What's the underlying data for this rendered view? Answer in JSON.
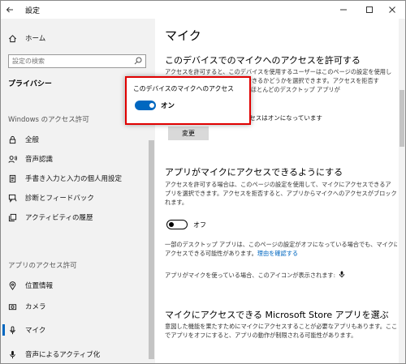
{
  "window": {
    "title": "設定"
  },
  "sidebar": {
    "home": "ホーム",
    "search_placeholder": "設定の検索",
    "section_title": "プライバシー",
    "group_windows": "Windows のアクセス許可",
    "windows_items": [
      {
        "label": "全般",
        "icon": "lock-icon"
      },
      {
        "label": "音声認識",
        "icon": "speech-icon"
      },
      {
        "label": "手書き入力と入力の個人用設定",
        "icon": "document-icon"
      },
      {
        "label": "診断とフィードバック",
        "icon": "feedback-icon"
      },
      {
        "label": "アクティビティの履歴",
        "icon": "history-icon"
      }
    ],
    "group_apps": "アプリのアクセス許可",
    "app_items": [
      {
        "label": "位置情報",
        "icon": "location-icon"
      },
      {
        "label": "カメラ",
        "icon": "camera-icon"
      },
      {
        "label": "マイク",
        "icon": "microphone-icon",
        "selected": true
      },
      {
        "label": "音声によるアクティブ化",
        "icon": "voice-activation-icon"
      }
    ]
  },
  "main": {
    "title": "マイク",
    "s1": {
      "heading": "このデバイスでのマイクへのアクセスを許可する",
      "p1": "アクセスを許可すると、このデバイスを使用するユーザーはこのページの設定を使用し",
      "p2": "て、アプリがマイクにアクセスできるかどうかを選択できます。アクセスを拒否す",
      "p3": "ると、Microsoft Store アプリ、ほとんどのデスクトップ アプリが",
      "status": "このデバイスのマイクへのアクセスはオンになっています",
      "change_button": "変更"
    },
    "s2": {
      "heading": "アプリがマイクにアクセスできるようにする",
      "p1": "アクセスを許可する場合は、このページの設定を使用して、マイクにアクセスできるア",
      "p2": "プリを選択できます。アクセスを拒否すると、アプリからマイクへのアクセスがブロックさ",
      "p3": "れます。",
      "toggle_label": "オフ",
      "toggle_state": "off",
      "note1": "一部のデスクトップ アプリは、このページの設定がオフになっている場合でも、マイクに",
      "note2_prefix": "アクセスできる可能性があります。",
      "note2_link": "理由を確認する",
      "icon_note": "アプリがマイクを使っている場合、このアイコンが表示されます:"
    },
    "s3": {
      "heading": "マイクにアクセスできる Microsoft Store アプリを選ぶ",
      "p1": "意図した機能を果たすためにマイクにアクセスすることが必要なアプリもあります。ここ",
      "p2": "でアプリをオフにすると、アプリの動作が制限される可能性があります。"
    }
  },
  "popup": {
    "title": "このデバイスのマイクへのアクセス",
    "toggle_label": "オン",
    "toggle_state": "on"
  },
  "colors": {
    "accent": "#0067c0",
    "highlight_border": "#e00000"
  }
}
